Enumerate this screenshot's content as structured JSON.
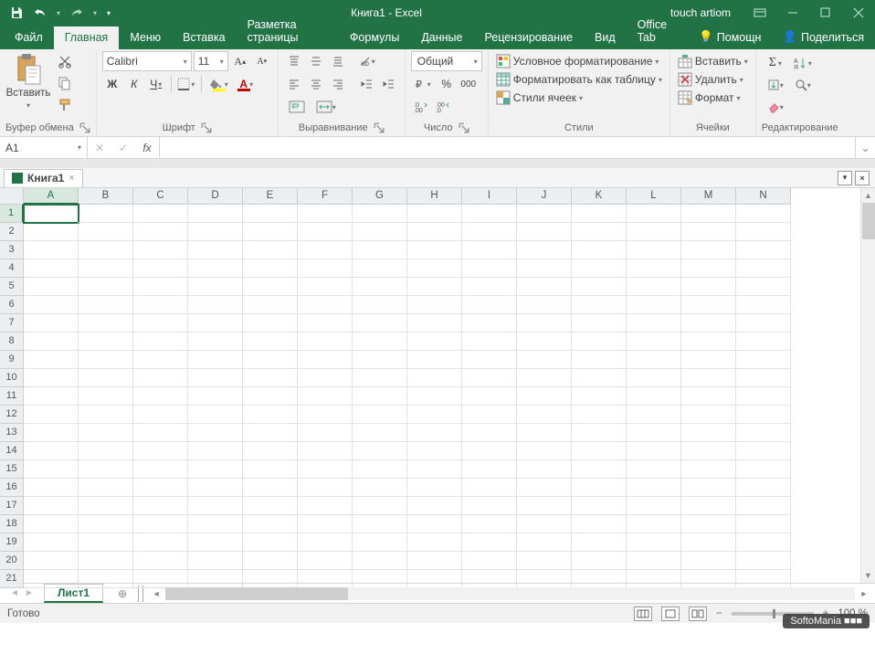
{
  "titlebar": {
    "title": "Книга1  -  Excel",
    "user": "touch artiom"
  },
  "tabs": {
    "file": "Файл",
    "home": "Главная",
    "menu": "Меню",
    "insert": "Вставка",
    "pagelayout": "Разметка страницы",
    "formulas": "Формулы",
    "data": "Данные",
    "review": "Рецензирование",
    "view": "Вид",
    "officetab": "Office Tab",
    "help": "Помощн",
    "share": "Поделиться"
  },
  "ribbon": {
    "clipboard": {
      "paste": "Вставить",
      "group": "Буфер обмена"
    },
    "font": {
      "name": "Calibri",
      "size": "11",
      "bold": "Ж",
      "italic": "К",
      "underline": "Ч",
      "group": "Шрифт"
    },
    "align": {
      "group": "Выравнивание"
    },
    "number": {
      "format": "Общий",
      "group": "Число"
    },
    "styles": {
      "cond": "Условное форматирование",
      "table": "Форматировать как таблицу",
      "cell": "Стили ячеек",
      "group": "Стили"
    },
    "cells": {
      "insert": "Вставить",
      "delete": "Удалить",
      "format": "Формат",
      "group": "Ячейки"
    },
    "editing": {
      "group": "Редактирование"
    }
  },
  "formula": {
    "namebox": "A1",
    "fx": "fx",
    "value": ""
  },
  "workbook": {
    "name": "Книга1"
  },
  "grid": {
    "cols": [
      "A",
      "B",
      "C",
      "D",
      "E",
      "F",
      "G",
      "H",
      "I",
      "J",
      "K",
      "L",
      "M",
      "N"
    ],
    "rows": [
      "1",
      "2",
      "3",
      "4",
      "5",
      "6",
      "7",
      "8",
      "9",
      "10",
      "11",
      "12",
      "13",
      "14",
      "15",
      "16",
      "17",
      "18",
      "19",
      "20",
      "21"
    ]
  },
  "sheets": {
    "active": "Лист1"
  },
  "status": {
    "ready": "Готово",
    "zoom": "100 %"
  },
  "watermark": "SoftoMania"
}
